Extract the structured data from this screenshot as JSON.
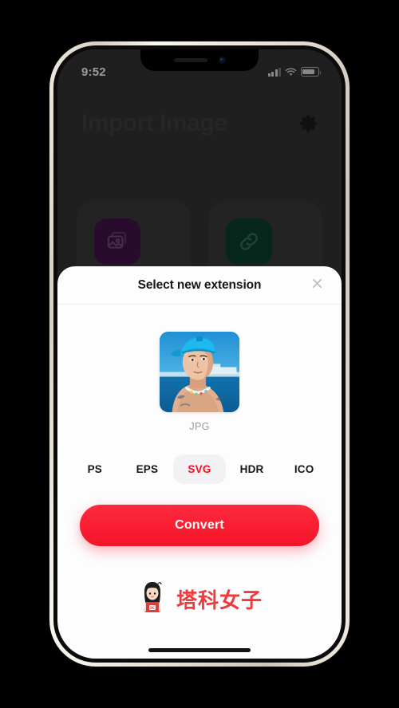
{
  "device": {
    "status_bar": {
      "time": "9:52",
      "signal_icon": "cellular-signal-icon",
      "wifi_icon": "wifi-icon",
      "battery_icon": "battery-icon"
    },
    "frame_color": "#e6dfd4",
    "home_indicator": "home-indicator"
  },
  "app_background": {
    "title": "Import Image",
    "settings_icon": "gear-icon",
    "cards": [
      {
        "icon": "photo-library-icon",
        "color": "#3d1245"
      },
      {
        "icon": "link-icon",
        "color": "#0b3a2b"
      }
    ]
  },
  "modal": {
    "title": "Select new extension",
    "close_icon": "close-icon",
    "preview": {
      "thumbnail_alt": "image-thumbnail",
      "format_label": "JPG"
    },
    "extensions": [
      {
        "label": "PS",
        "selected": false
      },
      {
        "label": "EPS",
        "selected": false
      },
      {
        "label": "SVG",
        "selected": true
      },
      {
        "label": "HDR",
        "selected": false
      },
      {
        "label": "ICO",
        "selected": false
      }
    ],
    "primary_action": "Convert",
    "accent_color": "#fa1f33",
    "selected_color": "#ff0a18"
  },
  "watermark": {
    "text": "塔科女子",
    "mascot_badge": "3C",
    "color": "#ef3b3b"
  }
}
